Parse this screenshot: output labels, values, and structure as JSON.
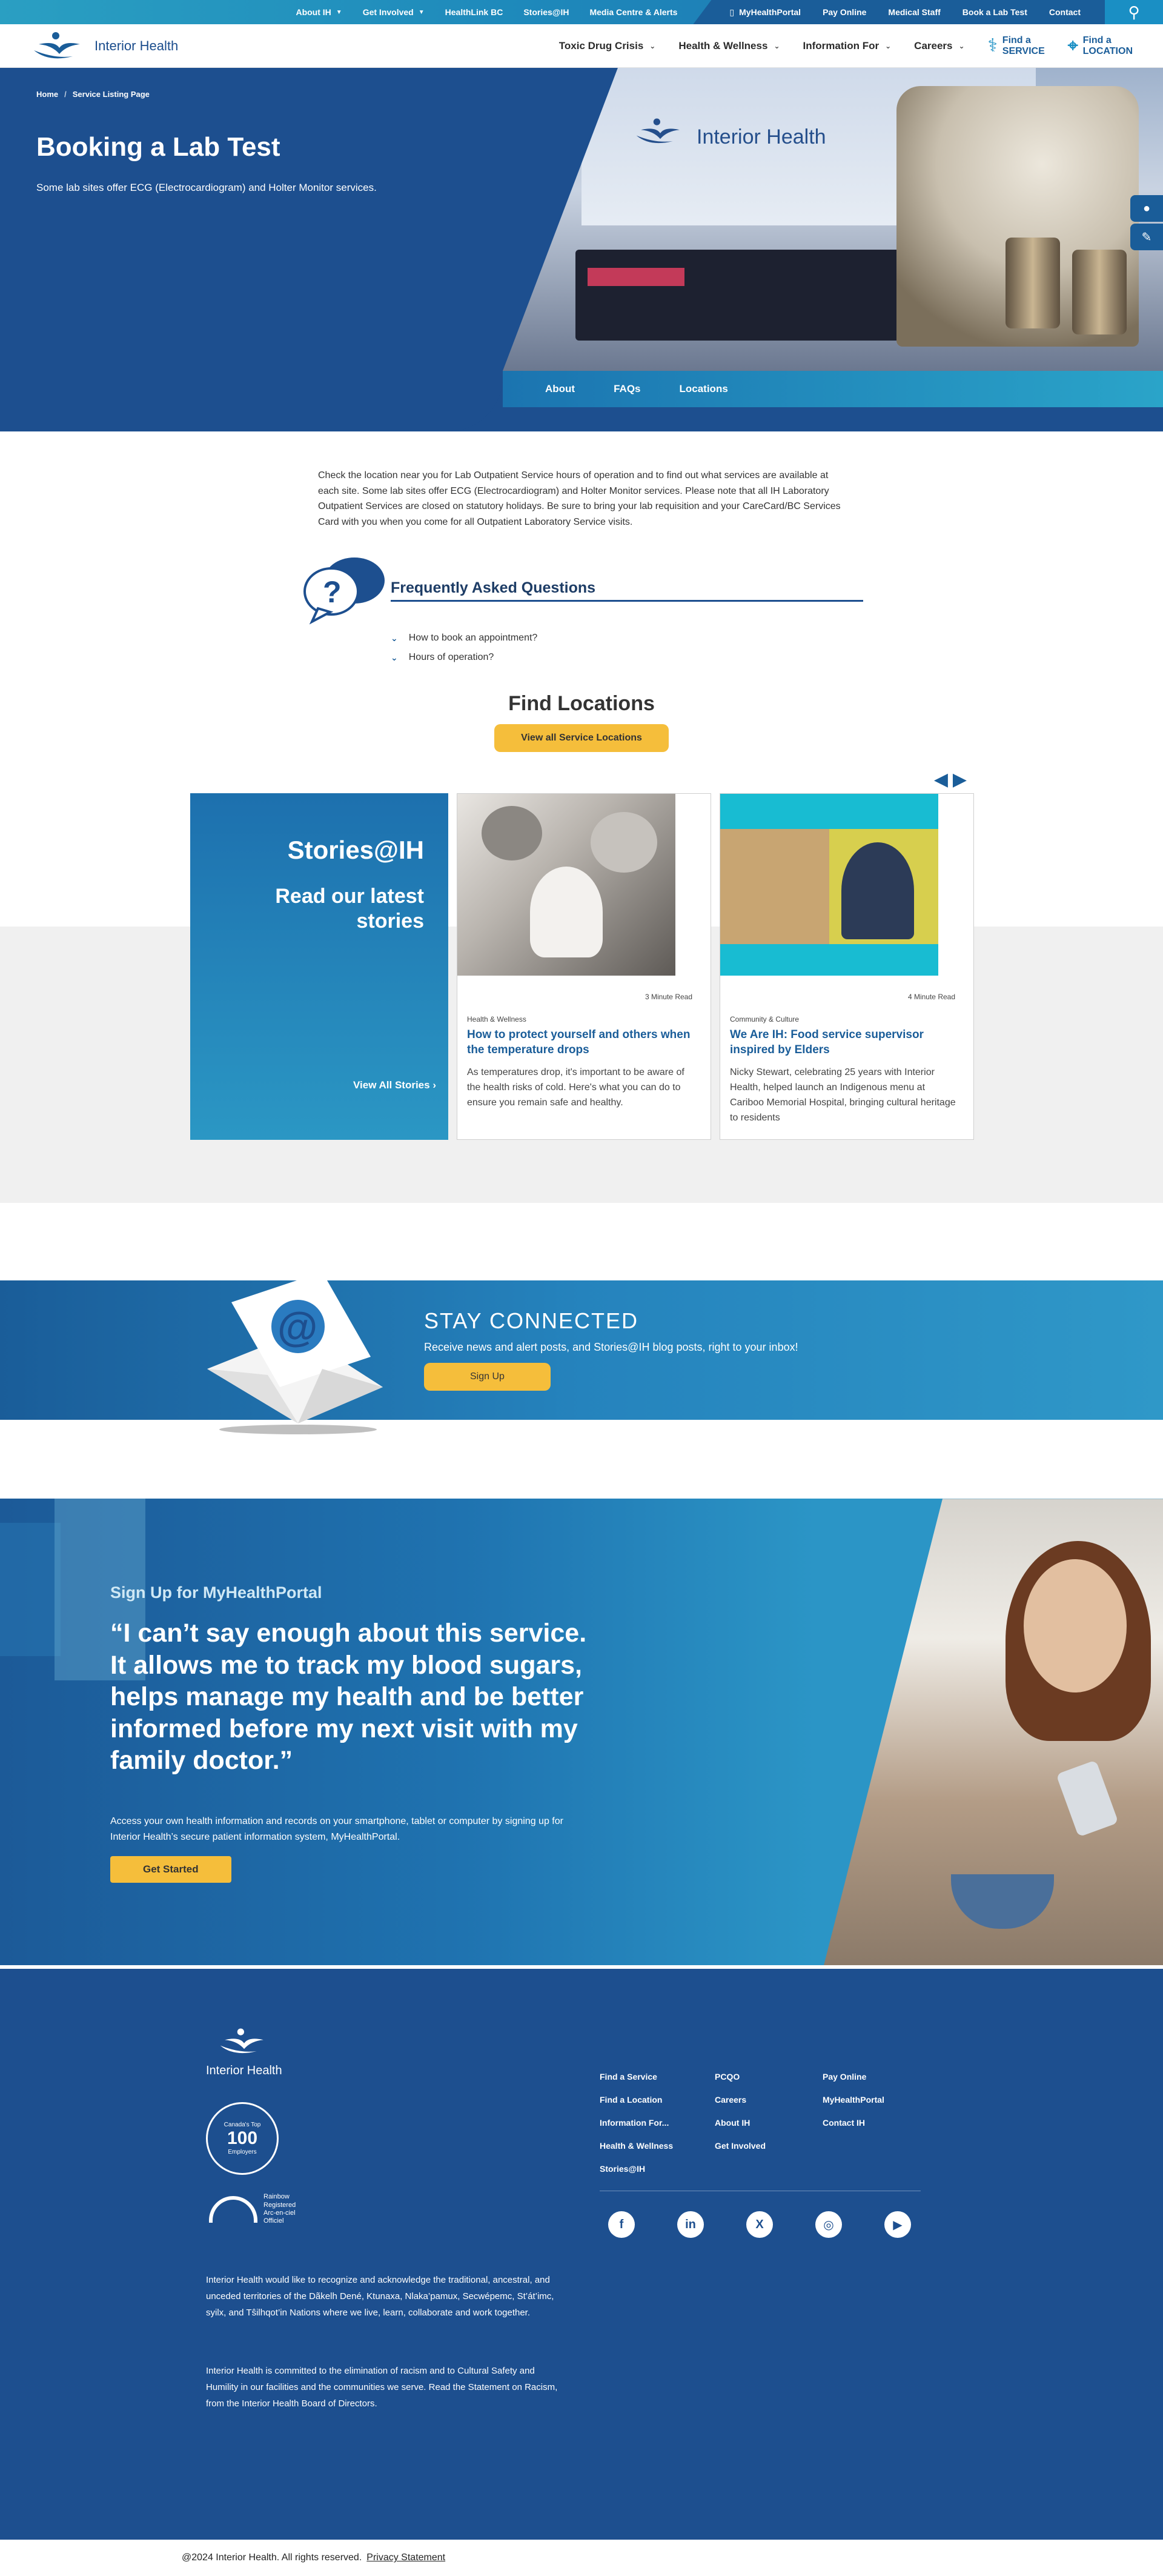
{
  "topbar": {
    "links_left": [
      {
        "label": "About IH",
        "dropdown": true
      },
      {
        "label": "Get Involved",
        "dropdown": true
      },
      {
        "label": "HealthLink BC",
        "dropdown": false
      },
      {
        "label": "Stories@IH",
        "dropdown": false
      },
      {
        "label": "Media Centre & Alerts",
        "dropdown": false
      }
    ],
    "links_right": [
      "MyHealthPortal",
      "Pay Online",
      "Medical Staff",
      "Book a Lab Test",
      "Contact"
    ]
  },
  "nav": {
    "logo_text": "Interior Health",
    "items": [
      "Toxic Drug Crisis",
      "Health & Wellness",
      "Information For",
      "Careers"
    ],
    "find_service": {
      "line1": "Find a",
      "line2": "SERVICE"
    },
    "find_location": {
      "line1": "Find a",
      "line2": "LOCATION"
    }
  },
  "hero": {
    "breadcrumb": [
      "Home",
      "Service Listing Page"
    ],
    "title": "Booking a Lab Test",
    "subtitle": "Some lab sites offer ECG (Electrocardiogram) and Holter Monitor services.",
    "banner_text": "Interior Health",
    "tabs": [
      "About",
      "FAQs",
      "Locations"
    ]
  },
  "intro": "Check the location near you for Lab Outpatient Service hours of operation and to find out what services are available at each site. Some lab sites offer ECG (Electrocardiogram) and Holter Monitor services. Please note that all IH Laboratory Outpatient Services are closed on statutory holidays. Be sure to bring your lab requisition and your CareCard/BC Services Card with you when you come for all Outpatient Laboratory Service visits.",
  "faq": {
    "title": "Frequently Asked Questions",
    "items": [
      "How to book an appointment?",
      "Hours of operation?"
    ]
  },
  "find_locations": {
    "title": "Find Locations",
    "button": "View all Service Locations"
  },
  "stories": {
    "title": "Stories@IH",
    "subtitle": "Read our latest stories",
    "view_all": "View All Stories",
    "items": [
      {
        "read_time": "3 Minute Read",
        "category": "Health & Wellness",
        "title": "How to protect yourself and others when the temperature drops",
        "desc": "As temperatures drop, it's important to be aware of the health risks of cold. Here's what you can do to ensure you remain safe and healthy."
      },
      {
        "read_time": "4 Minute Read",
        "category": "Community & Culture",
        "title": "We Are IH: Food service supervisor inspired by Elders",
        "desc": "Nicky Stewart, celebrating 25 years with Interior Health, helped launch an Indigenous menu at Cariboo Memorial Hospital, bringing cultural heritage to residents"
      }
    ]
  },
  "stay": {
    "title": "STAY CONNECTED",
    "text": "Receive news and alert posts, and Stories@IH blog posts, right to your inbox!",
    "button": "Sign Up"
  },
  "mhp": {
    "label": "Sign Up for MyHealthPortal",
    "quote": "“I can’t say enough about this service. It allows me to track my blood sugars, helps manage my health and be better informed before my next visit with my family doctor.”",
    "desc": "Access your own health information and records on your smartphone, tablet or computer by signing up for Interior Health’s secure patient information system, MyHealthPortal.",
    "button": "Get Started"
  },
  "footer": {
    "logo_text": "Interior Health",
    "badge": {
      "top": "Canada's Top",
      "big": "100",
      "bottom": "Employers"
    },
    "rainbow": [
      "Rainbow",
      "Registered",
      "Arc-en-ciel",
      "Officiel"
    ],
    "ack1": "Interior Health would like to recognize and acknowledge the traditional, ancestral, and unceded territories of the Dãkelh Dené, Ktunaxa, Nlaka’pamux, Secwépemc, St’át’imc, syilx, and Tŝilhqot’in Nations where we live, learn, collaborate and work together.",
    "ack2": "Interior Health is committed to the elimination of racism and to Cultural Safety and Humility in our facilities and the communities we serve. Read the Statement on Racism, from the Interior Health Board of Directors.",
    "links": [
      "Find a Service",
      "PCQO",
      "Pay Online",
      "Find a Location",
      "Careers",
      "MyHealthPortal",
      "Information For...",
      "About IH",
      "Contact IH",
      "Health & Wellness",
      "Get Involved",
      "",
      "Stories@IH",
      "",
      ""
    ],
    "social": [
      "f",
      "in",
      "X",
      "◎",
      "▶"
    ]
  },
  "copyright": {
    "text": "@2024  Interior Health. All rights reserved.",
    "privacy": "Privacy Statement"
  },
  "colors": {
    "navy": "#1d4f8f",
    "blue": "#1a5d99",
    "cyan": "#2aa4c9",
    "yellow": "#f5be3b"
  }
}
